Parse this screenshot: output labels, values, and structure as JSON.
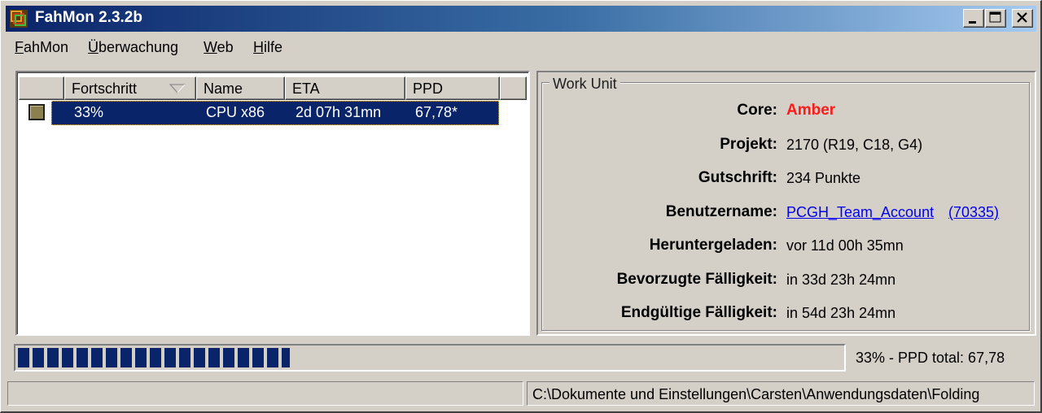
{
  "window": {
    "title": "FahMon 2.3.2b"
  },
  "menu": [
    {
      "label_first": "F",
      "label_rest": "ahMon"
    },
    {
      "label_first": "Ü",
      "label_rest": "berwachung"
    },
    {
      "label_first": "W",
      "label_rest": "eb"
    },
    {
      "label_first": "H",
      "label_rest": "ilfe"
    }
  ],
  "table": {
    "columns": [
      "",
      "Fortschritt",
      "Name",
      "ETA",
      "PPD"
    ],
    "rows": [
      {
        "progress": "33%",
        "name": "CPU x86",
        "eta": "2d 07h 31mn",
        "ppd": "67,78*"
      }
    ]
  },
  "work_unit": {
    "legend": "Work Unit",
    "core_label": "Core:",
    "core_value": "Amber",
    "project_label": "Projekt:",
    "project_value": "2170 (R19, C18, G4)",
    "credit_label": "Gutschrift:",
    "credit_value": "234 Punkte",
    "username_label": "Benutzername:",
    "username_value": "PCGH_Team_Account",
    "team_value": "(70335)",
    "downloaded_label": "Heruntergeladen:",
    "downloaded_value": "vor 11d 00h 35mn",
    "preferred_label": "Bevorzugte Fälligkeit:",
    "preferred_value": "in 33d 23h 24mn",
    "final_label": "Endgültige Fälligkeit:",
    "final_value": "in 54d 23h 24mn"
  },
  "progress": {
    "fraction": 0.33,
    "text": "33%  -  PPD total: 67,78"
  },
  "statusbar": {
    "left": "",
    "path": "C:\\Dokumente und Einstellungen\\Carsten\\Anwendungsdaten\\Folding"
  },
  "colors": {
    "selection": "#0a246a",
    "core": "#ff1a1a",
    "link": "#0000ee"
  },
  "icons": {
    "app": "fahmon-app-icon",
    "client_state": "client-status-icon"
  }
}
